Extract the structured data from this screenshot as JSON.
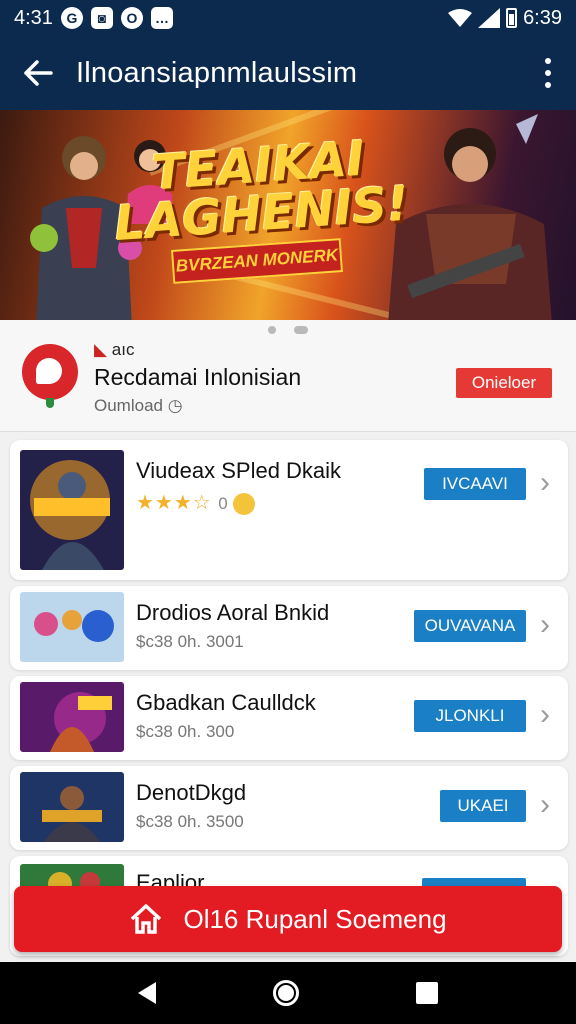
{
  "status_bar": {
    "time": "4:31",
    "icons": [
      "g-icon",
      "camera-icon",
      "o-icon",
      "chat-icon"
    ],
    "right_text": "6:39"
  },
  "app_bar": {
    "title": "Ilnoansiapnmlaulssim"
  },
  "banner": {
    "title_line1": "TEAIKAI",
    "title_line2": "LAGHENIS!",
    "subtitle": "BVRZEAN MONERK",
    "page_indicator_count": 2
  },
  "featured_app": {
    "tag": "aıc",
    "name": "Recdamai Inlonisian",
    "meta": "Oumload",
    "install_label": "Onieloer"
  },
  "list": [
    {
      "title": "Viudeax SPled Dkaik",
      "rating_text": "0",
      "button": "IVCAAVI"
    },
    {
      "title": "Drodios Aoral Bnkid",
      "subtitle": "$c38 0h. 3001",
      "button": "OUVAVANA"
    },
    {
      "title": "Gbadkan Caulldck",
      "subtitle": "$c38 0h. 300",
      "button": "JLONKLI"
    },
    {
      "title": "DenotDkgd",
      "subtitle": "$c38 0h. 3500",
      "button": "UKAEI"
    },
    {
      "title": "Eaplior"
    }
  ],
  "fab": {
    "label": "Ol16 Rupanl Soemeng"
  },
  "colors": {
    "app_bar": "#0b2a4d",
    "accent_red": "#e31c23",
    "button_blue": "#1a7fc4"
  }
}
